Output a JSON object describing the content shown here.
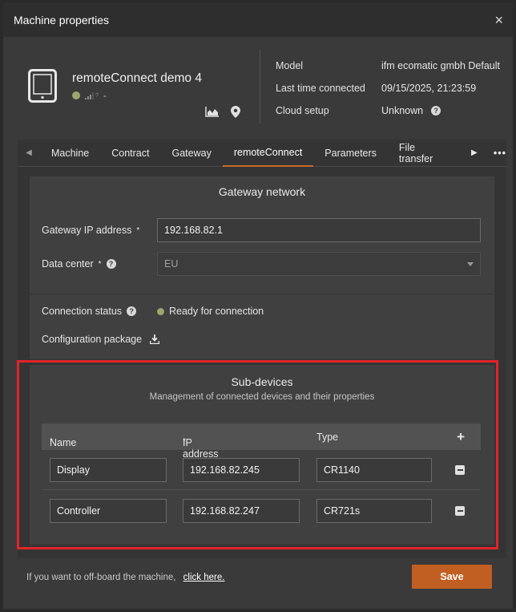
{
  "dialog": {
    "title": "Machine properties",
    "close_label": "×"
  },
  "device": {
    "name": "remoteConnect demo 4",
    "status_text": "-"
  },
  "meta": [
    {
      "key": "Model",
      "value": "ifm ecomatic gmbh Default"
    },
    {
      "key": "Last time connected",
      "value": "09/15/2025, 21:23:59"
    },
    {
      "key": "Cloud setup",
      "value": "Unknown"
    }
  ],
  "tabs": [
    {
      "label": "Machine"
    },
    {
      "label": "Contract"
    },
    {
      "label": "Gateway"
    },
    {
      "label": "remoteConnect",
      "active": true
    },
    {
      "label": "Parameters"
    },
    {
      "label": "File transfer"
    }
  ],
  "tabs_more": "•••",
  "gateway_network": {
    "heading": "Gateway network",
    "ip_label": "Gateway IP address",
    "ip_value": "192.168.82.1",
    "datacenter_label": "Data center",
    "datacenter_value": "EU"
  },
  "connection": {
    "status_label": "Connection status",
    "status_value": "Ready for connection",
    "package_label": "Configuration package"
  },
  "subdevices": {
    "heading": "Sub-devices",
    "subtitle": "Management of connected devices and their properties",
    "columns": {
      "name": "Name",
      "ip": "IP address",
      "type": "Type"
    },
    "rows": [
      {
        "name": "Display",
        "ip": "192.168.82.245",
        "type": "CR1140"
      },
      {
        "name": "Controller",
        "ip": "192.168.82.247",
        "type": "CR721s"
      }
    ]
  },
  "footer": {
    "message": "If you want to off-board the machine,",
    "link": "click here.",
    "save_label": "Save"
  },
  "colors": {
    "accent": "#c15f23",
    "status_ok": "#9aa86b",
    "highlight": "#e0242a"
  }
}
